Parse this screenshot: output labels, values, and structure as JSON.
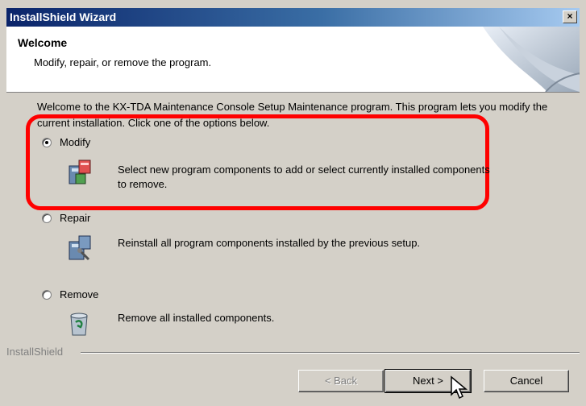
{
  "window": {
    "title": "InstallShield Wizard",
    "close_glyph": "×"
  },
  "header": {
    "title": "Welcome",
    "subtitle": "Modify, repair, or remove the program."
  },
  "intro": "Welcome to the KX-TDA Maintenance Console Setup Maintenance program. This program lets you modify the current installation. Click one of the options below.",
  "options": [
    {
      "label": "Modify",
      "checked": true,
      "icon": "modify-icon",
      "description": "Select new program components to add or select currently installed components to remove."
    },
    {
      "label": "Repair",
      "checked": false,
      "icon": "repair-icon",
      "description": "Reinstall all program components installed by the previous setup."
    },
    {
      "label": "Remove",
      "checked": false,
      "icon": "remove-icon",
      "description": "Remove all installed components."
    }
  ],
  "footer": {
    "brand": "InstallShield",
    "back_label": "< Back",
    "next_label": "Next >",
    "cancel_label": "Cancel"
  },
  "colors": {
    "highlight": "#ff0000",
    "title_bar": "#0a246a",
    "dialog": "#d4d0c8"
  }
}
